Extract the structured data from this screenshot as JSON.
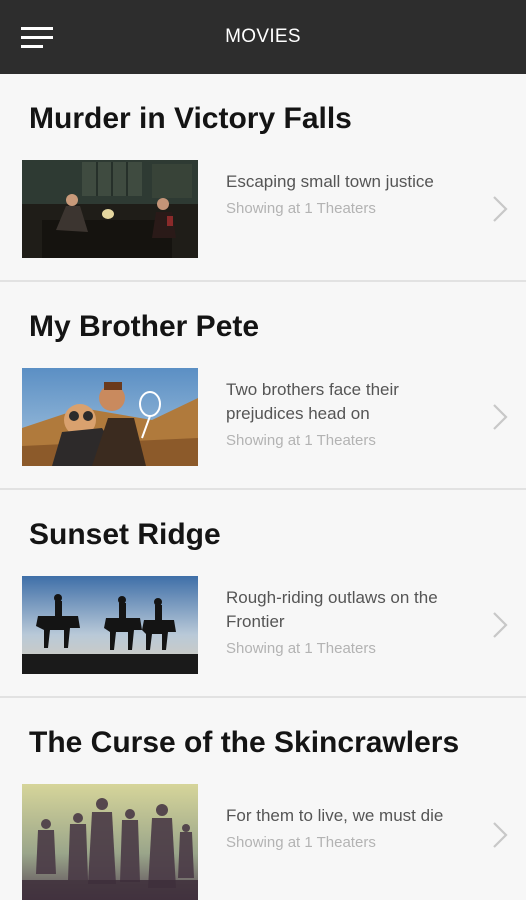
{
  "header": {
    "title": "MOVIES",
    "menu_icon": "hamburger-menu-icon",
    "background": "#2d2d2d"
  },
  "movies": [
    {
      "title": "Murder in Victory Falls",
      "tagline": "Escaping small town justice",
      "showing": "Showing at 1 Theaters"
    },
    {
      "title": "My Brother Pete",
      "tagline": "Two brothers face their prejudices head on",
      "showing": "Showing at 1 Theaters"
    },
    {
      "title": "Sunset Ridge",
      "tagline": "Rough-riding outlaws on the Frontier",
      "showing": "Showing at 1 Theaters"
    },
    {
      "title": "The Curse of the Skincrawlers",
      "tagline": "For them to live, we must die",
      "showing": "Showing at 1 Theaters"
    }
  ]
}
